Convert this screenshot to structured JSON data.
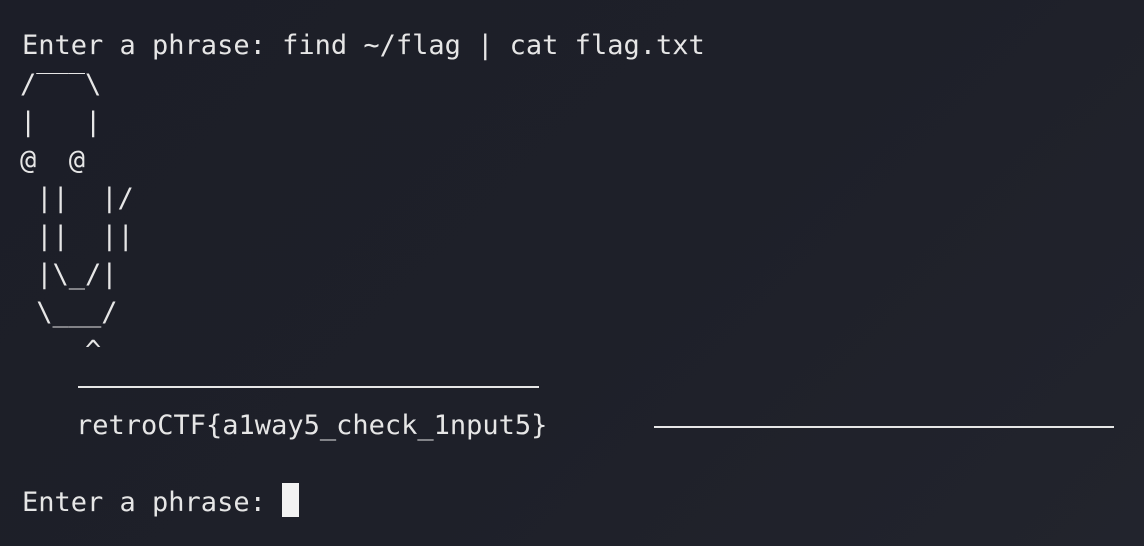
{
  "terminal": {
    "line1": "Enter a phrase: find ~/flag | cat flag.txt",
    "ascii_art": "/‾‾‾\\\n|   |\n@  @\n ||  |/\n ||  ||\n |\\_/|\n \\___/\n    ^",
    "flag_output": "retroCTF{a1way5_check_1nput5}",
    "prompt": "Enter a phrase: "
  }
}
